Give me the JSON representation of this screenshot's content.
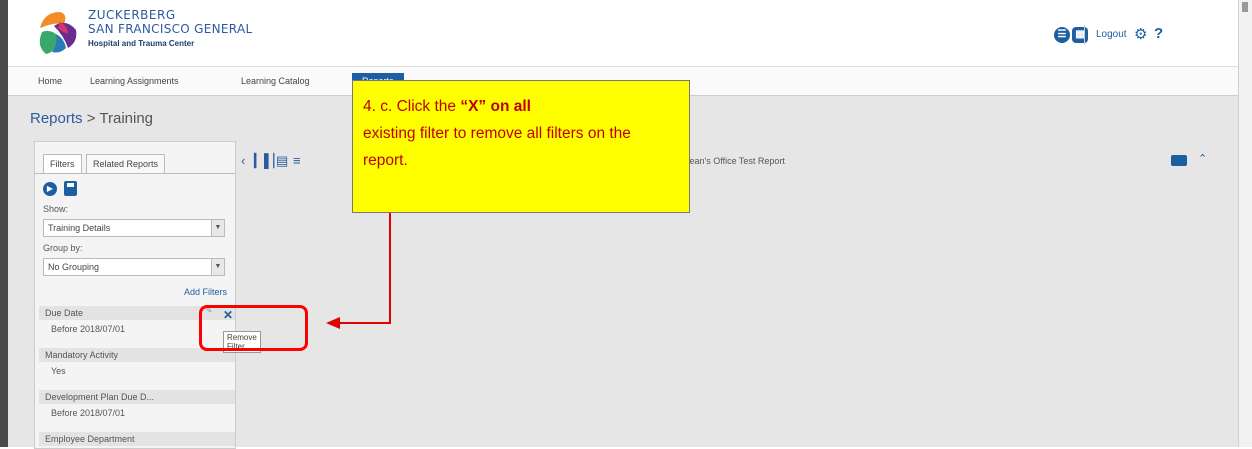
{
  "header": {
    "brand_line1": "ZUCKERBERG",
    "brand_line2": "SAN FRANCISCO GENERAL",
    "brand_line3": "Hospital and Trauma Center",
    "logout_label": "Logout",
    "help_label": "?"
  },
  "nav": {
    "items": [
      "Home",
      "Learning Assignments",
      "Learning Catalog",
      "Reports"
    ]
  },
  "breadcrumb": {
    "section": "Reports",
    "separator": ">",
    "page": "Training"
  },
  "panel": {
    "tabs": [
      "Filters",
      "Related Reports"
    ],
    "show_label": "Show:",
    "show_value": "Training Details",
    "group_label": "Group by:",
    "group_value": "No Grouping",
    "add_filters": "Add Filters",
    "filters": [
      {
        "name": "Due Date",
        "value": "Before 2018/07/01"
      },
      {
        "name": "Mandatory Activity",
        "value": "Yes"
      },
      {
        "name": "Development Plan Due D...",
        "value": "Before 2018/07/01"
      },
      {
        "name": "Employee Department",
        "value": ""
      }
    ],
    "remove_tooltip": "Remove Filter"
  },
  "report": {
    "title": "Dean's Office Test Report"
  },
  "annotation": {
    "step": "4. c. Click the ",
    "bold": "“X” on all",
    "rest": "existing filter to remove all filters on the report."
  },
  "colors": {
    "accent": "#1d5fa3",
    "callout": "#ffff00",
    "highlight": "#ff0000"
  }
}
